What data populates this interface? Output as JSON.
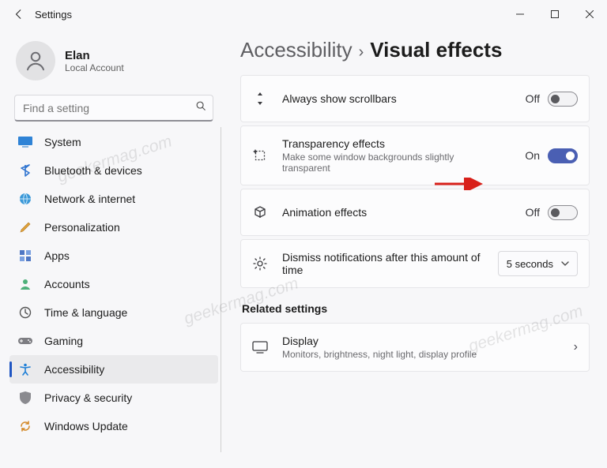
{
  "window": {
    "title": "Settings"
  },
  "user": {
    "name": "Elan",
    "role": "Local Account"
  },
  "search": {
    "placeholder": "Find a setting"
  },
  "sidebar": {
    "items": [
      {
        "label": "System",
        "icon": "monitor-icon",
        "selected": false
      },
      {
        "label": "Bluetooth & devices",
        "icon": "bluetooth-icon",
        "selected": false
      },
      {
        "label": "Network & internet",
        "icon": "globe-icon",
        "selected": false
      },
      {
        "label": "Personalization",
        "icon": "paintbrush-icon",
        "selected": false
      },
      {
        "label": "Apps",
        "icon": "grid-icon",
        "selected": false
      },
      {
        "label": "Accounts",
        "icon": "person-icon",
        "selected": false
      },
      {
        "label": "Time & language",
        "icon": "clock-icon",
        "selected": false
      },
      {
        "label": "Gaming",
        "icon": "gamepad-icon",
        "selected": false
      },
      {
        "label": "Accessibility",
        "icon": "accessibility-icon",
        "selected": true
      },
      {
        "label": "Privacy & security",
        "icon": "shield-icon",
        "selected": false
      },
      {
        "label": "Windows Update",
        "icon": "update-icon",
        "selected": false
      }
    ]
  },
  "breadcrumb": {
    "parent": "Accessibility",
    "current": "Visual effects"
  },
  "settings": {
    "scrollbars": {
      "title": "Always show scrollbars",
      "state_label": "Off",
      "on": false
    },
    "transparency": {
      "title": "Transparency effects",
      "desc": "Make some window backgrounds slightly transparent",
      "state_label": "On",
      "on": true
    },
    "animation": {
      "title": "Animation effects",
      "state_label": "Off",
      "on": false
    },
    "dismiss": {
      "title": "Dismiss notifications after this amount of time",
      "value": "5 seconds"
    }
  },
  "related": {
    "heading": "Related settings",
    "display": {
      "title": "Display",
      "desc": "Monitors, brightness, night light, display profile"
    }
  },
  "watermark": "geekermag.com"
}
